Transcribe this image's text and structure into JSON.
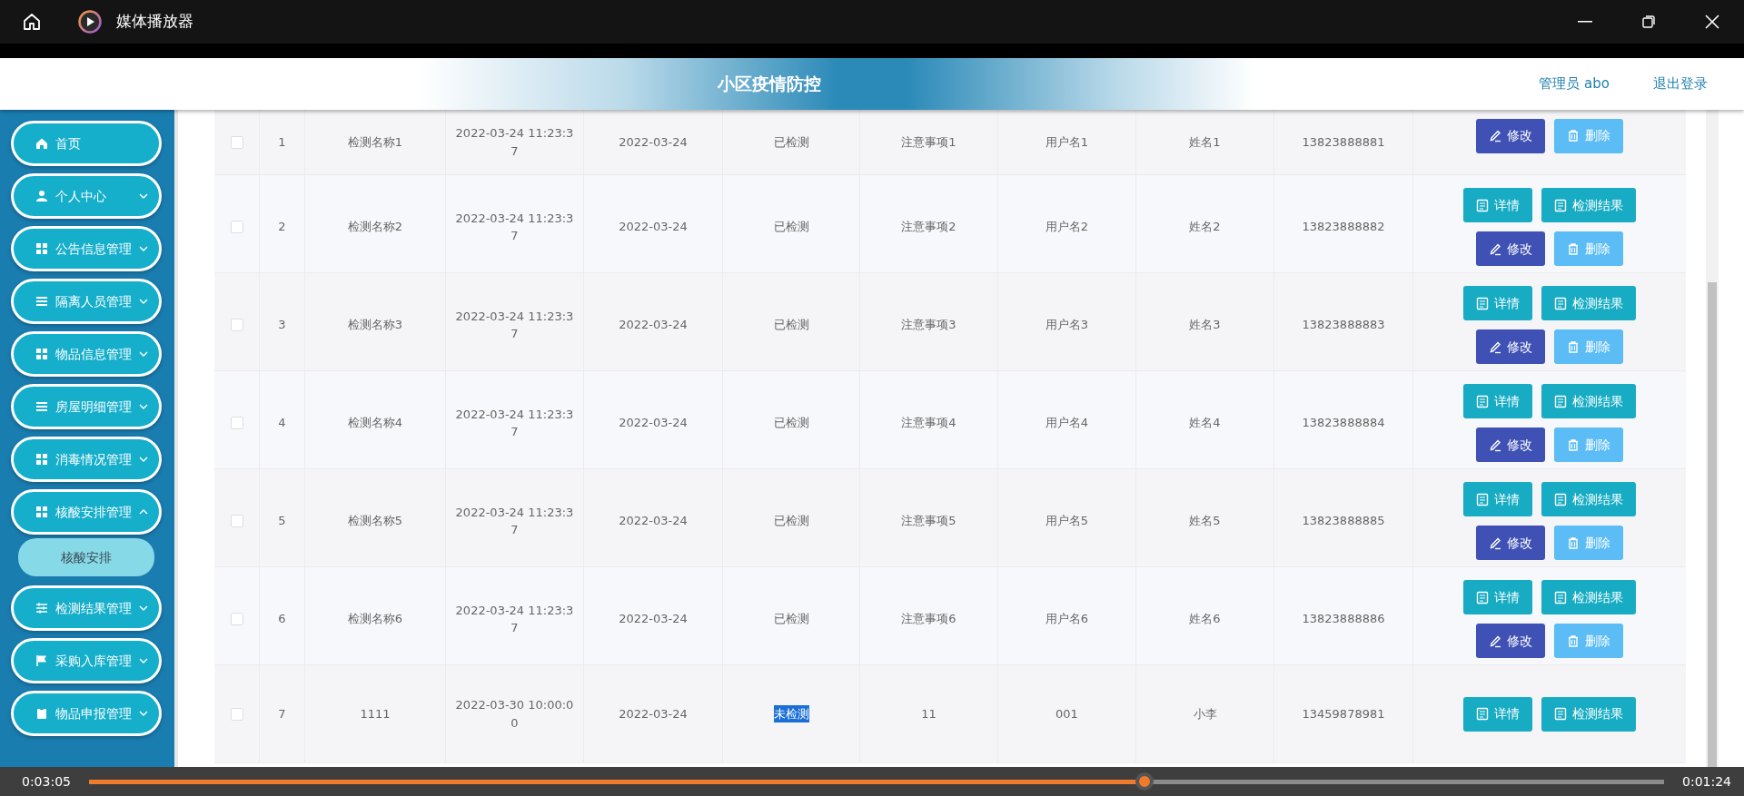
{
  "window": {
    "title": "媒体播放器"
  },
  "header": {
    "title": "小区疫情防控",
    "user": "管理员 abo",
    "logout": "退出登录"
  },
  "sidebar": {
    "items": [
      {
        "label": "首页",
        "expandable": false,
        "expanded": false
      },
      {
        "label": "个人中心",
        "expandable": true,
        "expanded": false
      },
      {
        "label": "公告信息管理",
        "expandable": true,
        "expanded": false
      },
      {
        "label": "隔离人员管理",
        "expandable": true,
        "expanded": false
      },
      {
        "label": "物品信息管理",
        "expandable": true,
        "expanded": false
      },
      {
        "label": "房屋明细管理",
        "expandable": true,
        "expanded": false
      },
      {
        "label": "消毒情况管理",
        "expandable": true,
        "expanded": false
      },
      {
        "label": "核酸安排管理",
        "expandable": true,
        "expanded": true,
        "children": [
          {
            "label": "核酸安排"
          }
        ]
      },
      {
        "label": "检测结果管理",
        "expandable": true,
        "expanded": false
      },
      {
        "label": "采购入库管理",
        "expandable": true,
        "expanded": false
      },
      {
        "label": "物品申报管理",
        "expandable": true,
        "expanded": false
      }
    ]
  },
  "table": {
    "rows": [
      {
        "checked": false,
        "index": "1",
        "name": "检测名称1",
        "time": "2022-03-24 11:23:37",
        "date": "2022-03-24",
        "status": "已检测",
        "status_highlighted": false,
        "notes": "注意事项1",
        "username": "用户名1",
        "person": "姓名1",
        "phone": "13823888881",
        "actions": [
          {
            "kind": "edit",
            "label": "修改"
          },
          {
            "kind": "delete",
            "label": "删除"
          }
        ]
      },
      {
        "checked": false,
        "index": "2",
        "name": "检测名称2",
        "time": "2022-03-24 11:23:37",
        "date": "2022-03-24",
        "status": "已检测",
        "status_highlighted": false,
        "notes": "注意事项2",
        "username": "用户名2",
        "person": "姓名2",
        "phone": "13823888882",
        "actions": [
          {
            "kind": "detail",
            "label": "详情"
          },
          {
            "kind": "result",
            "label": "检测结果"
          },
          {
            "kind": "edit",
            "label": "修改"
          },
          {
            "kind": "delete",
            "label": "删除"
          }
        ]
      },
      {
        "checked": false,
        "index": "3",
        "name": "检测名称3",
        "time": "2022-03-24 11:23:37",
        "date": "2022-03-24",
        "status": "已检测",
        "status_highlighted": false,
        "notes": "注意事项3",
        "username": "用户名3",
        "person": "姓名3",
        "phone": "13823888883",
        "actions": [
          {
            "kind": "detail",
            "label": "详情"
          },
          {
            "kind": "result",
            "label": "检测结果"
          },
          {
            "kind": "edit",
            "label": "修改"
          },
          {
            "kind": "delete",
            "label": "删除"
          }
        ]
      },
      {
        "checked": false,
        "index": "4",
        "name": "检测名称4",
        "time": "2022-03-24 11:23:37",
        "date": "2022-03-24",
        "status": "已检测",
        "status_highlighted": false,
        "notes": "注意事项4",
        "username": "用户名4",
        "person": "姓名4",
        "phone": "13823888884",
        "actions": [
          {
            "kind": "detail",
            "label": "详情"
          },
          {
            "kind": "result",
            "label": "检测结果"
          },
          {
            "kind": "edit",
            "label": "修改"
          },
          {
            "kind": "delete",
            "label": "删除"
          }
        ]
      },
      {
        "checked": false,
        "index": "5",
        "name": "检测名称5",
        "time": "2022-03-24 11:23:37",
        "date": "2022-03-24",
        "status": "已检测",
        "status_highlighted": false,
        "notes": "注意事项5",
        "username": "用户名5",
        "person": "姓名5",
        "phone": "13823888885",
        "actions": [
          {
            "kind": "detail",
            "label": "详情"
          },
          {
            "kind": "result",
            "label": "检测结果"
          },
          {
            "kind": "edit",
            "label": "修改"
          },
          {
            "kind": "delete",
            "label": "删除"
          }
        ]
      },
      {
        "checked": false,
        "index": "6",
        "name": "检测名称6",
        "time": "2022-03-24 11:23:37",
        "date": "2022-03-24",
        "status": "已检测",
        "status_highlighted": false,
        "notes": "注意事项6",
        "username": "用户名6",
        "person": "姓名6",
        "phone": "13823888886",
        "actions": [
          {
            "kind": "detail",
            "label": "详情"
          },
          {
            "kind": "result",
            "label": "检测结果"
          },
          {
            "kind": "edit",
            "label": "修改"
          },
          {
            "kind": "delete",
            "label": "删除"
          }
        ]
      },
      {
        "checked": false,
        "index": "7",
        "name": "1111",
        "time": "2022-03-30 10:00:00",
        "date": "2022-03-24",
        "status": "未检测",
        "status_highlighted": true,
        "notes": "11",
        "username": "001",
        "person": "小李",
        "phone": "13459878981",
        "actions": [
          {
            "kind": "detail",
            "label": "详情"
          },
          {
            "kind": "result",
            "label": "检测结果"
          }
        ]
      }
    ]
  },
  "player": {
    "elapsed": "0:03:05",
    "remaining": "0:01:24",
    "level": 0.67
  }
}
